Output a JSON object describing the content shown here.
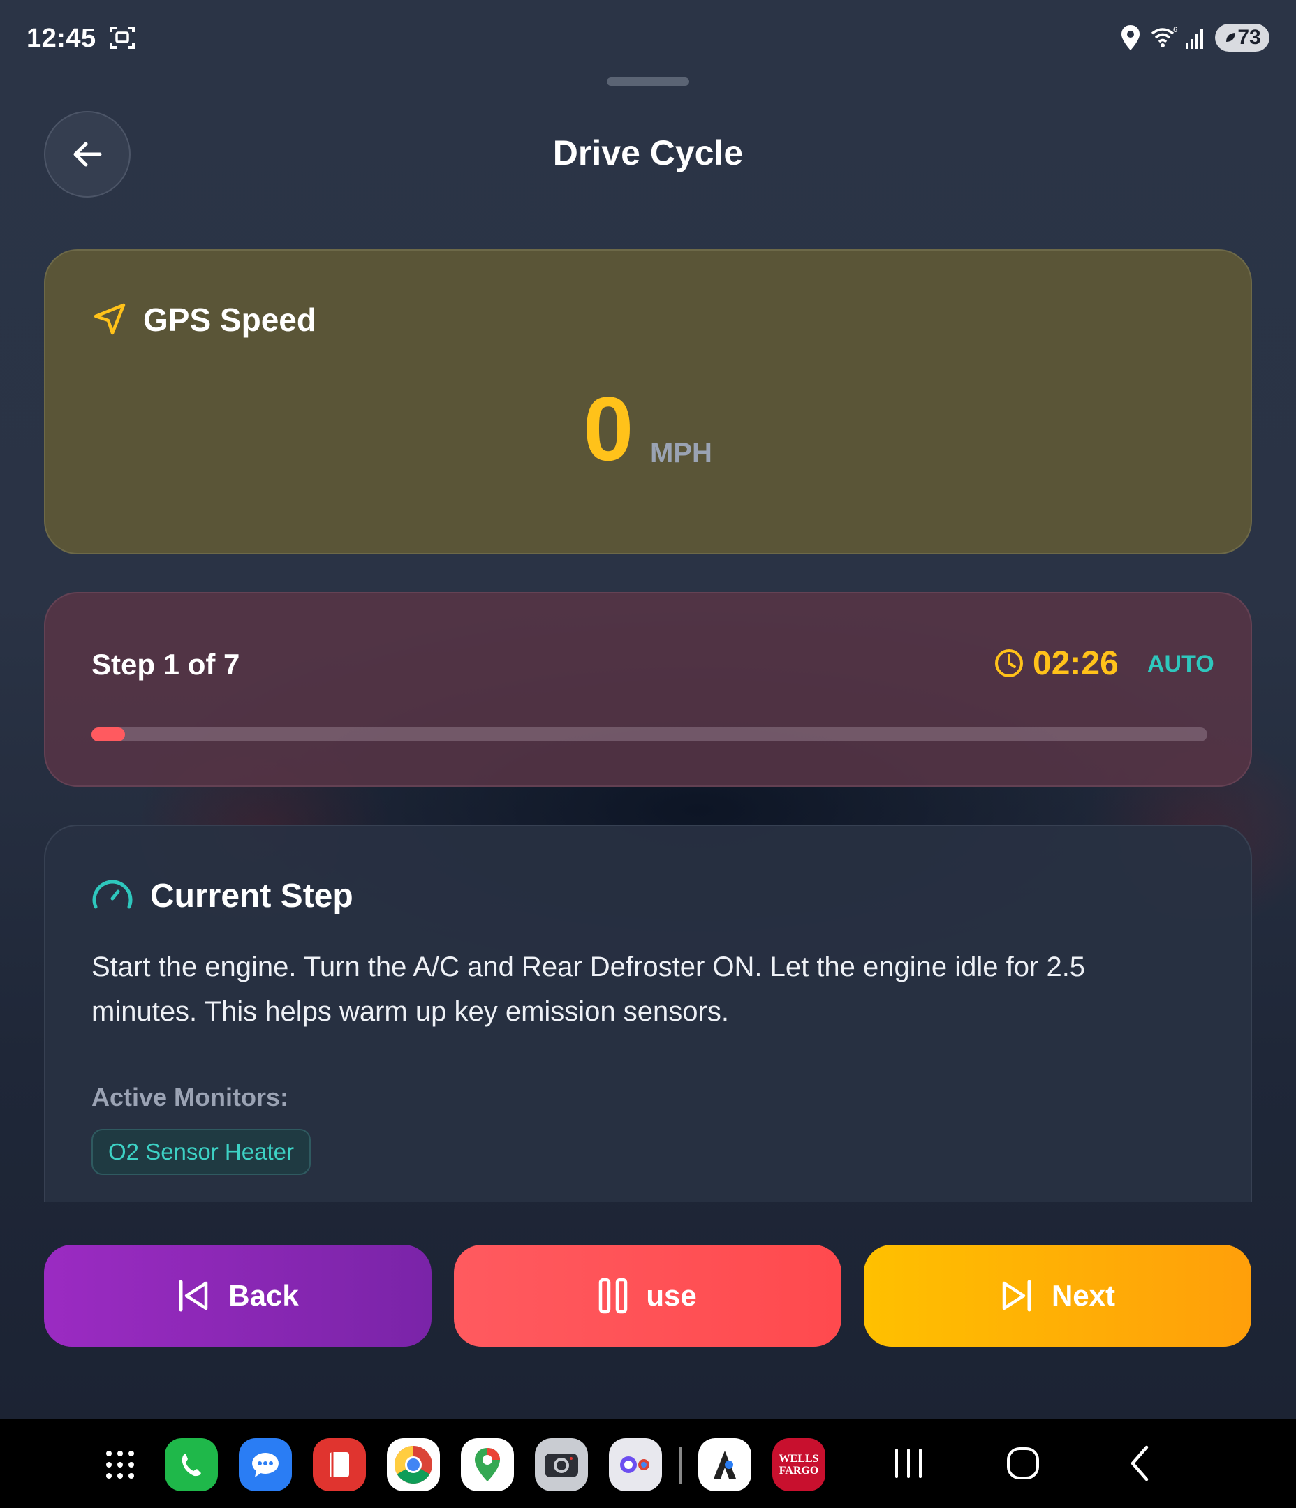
{
  "status_bar": {
    "time": "12:45",
    "battery": "73"
  },
  "header": {
    "title": "Drive Cycle"
  },
  "gps": {
    "title": "GPS Speed",
    "speed": "0",
    "unit": "MPH"
  },
  "step": {
    "label": "Step 1 of 7",
    "timer": "02:26",
    "mode": "AUTO",
    "progress_percent": 3
  },
  "current_step": {
    "title": "Current Step",
    "description": "Start the engine. Turn the A/C and Rear Defroster ON. Let the engine idle for 2.5 minutes. This helps warm up key emission sensors.",
    "monitors_label": "Active Monitors:",
    "monitors": [
      "O2 Sensor Heater"
    ]
  },
  "controls": {
    "back_label": "Back",
    "pause_label": "use",
    "next_label": "Next"
  },
  "colors": {
    "accent_yellow": "#ffc21a",
    "accent_teal": "#2ec7bd",
    "progress_red": "#ff5a5f",
    "back_purple": "#9b2bc2",
    "pause_red": "#ff5a5f",
    "next_orange": "#ffb000"
  },
  "dock": {
    "apps": [
      "apps-grid-icon",
      "phone-icon",
      "messages-icon",
      "notes-icon",
      "chrome-icon",
      "maps-icon",
      "camera-icon",
      "browser-icon",
      "app-icon",
      "bank-icon"
    ],
    "bank_logo_line1": "WELLS",
    "bank_logo_line2": "FARGO"
  }
}
